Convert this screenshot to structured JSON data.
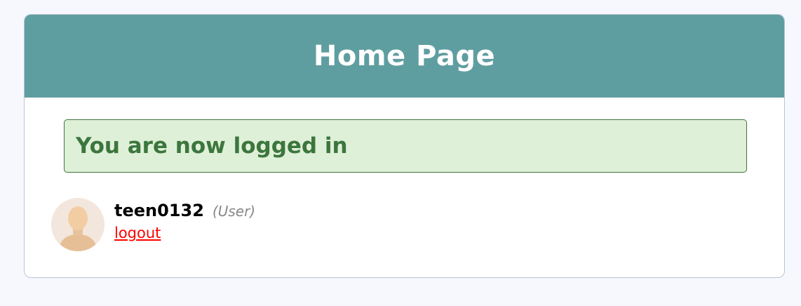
{
  "header": {
    "title": "Home Page"
  },
  "alert": {
    "message": "You are now logged in",
    "color": "#3c763d",
    "background": "#dff0d8"
  },
  "user": {
    "username": "teen0132",
    "role": "(User)",
    "avatar_icon": "user-avatar-icon"
  },
  "actions": {
    "logout_label": "logout"
  },
  "colors": {
    "header_background": "#5f9ea0",
    "logout_link": "#ff0000",
    "page_background": "#f7f8fd"
  }
}
